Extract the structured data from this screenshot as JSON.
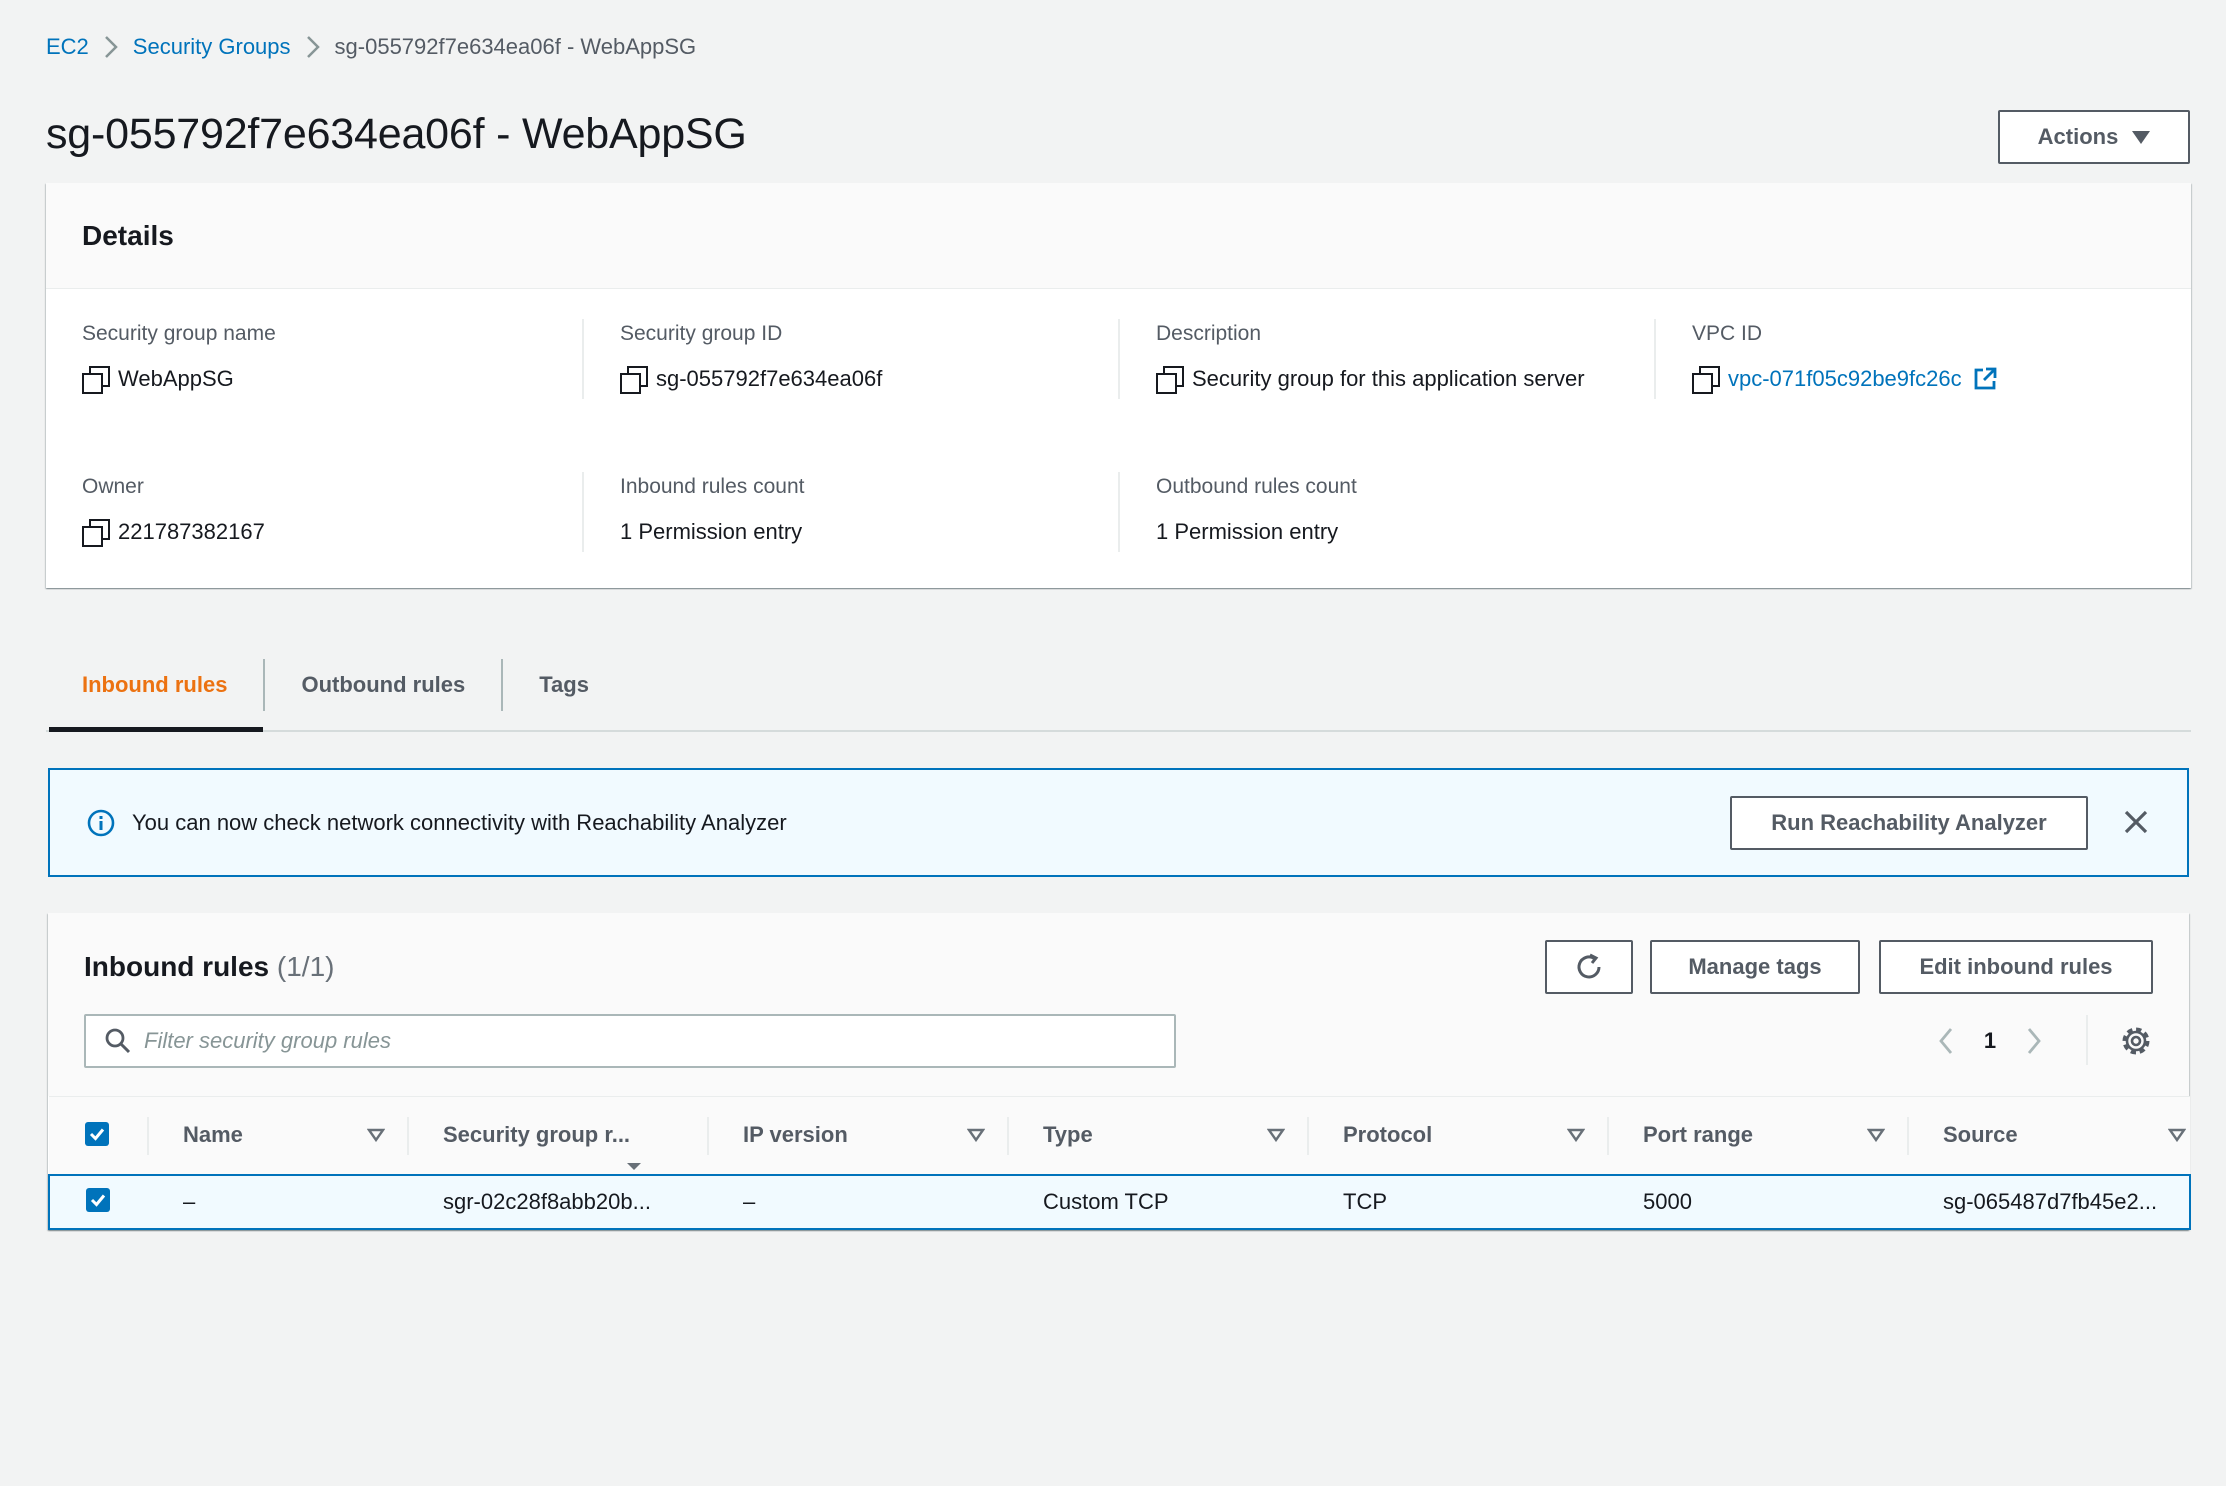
{
  "breadcrumb": {
    "root": "EC2",
    "parent": "Security Groups",
    "current": "sg-055792f7e634ea06f - WebAppSG"
  },
  "page": {
    "title": "sg-055792f7e634ea06f - WebAppSG",
    "actions_label": "Actions"
  },
  "details": {
    "heading": "Details",
    "fields": {
      "sg_name": {
        "label": "Security group name",
        "value": "WebAppSG"
      },
      "sg_id": {
        "label": "Security group ID",
        "value": "sg-055792f7e634ea06f"
      },
      "description": {
        "label": "Description",
        "value": "Security group for this application server"
      },
      "vpc_id": {
        "label": "VPC ID",
        "value": "vpc-071f05c92be9fc26c"
      },
      "owner": {
        "label": "Owner",
        "value": "221787382167"
      },
      "inbound_count": {
        "label": "Inbound rules count",
        "value": "1 Permission entry"
      },
      "outbound_count": {
        "label": "Outbound rules count",
        "value": "1 Permission entry"
      }
    }
  },
  "tabs": [
    {
      "label": "Inbound rules",
      "active": true
    },
    {
      "label": "Outbound rules",
      "active": false
    },
    {
      "label": "Tags",
      "active": false
    }
  ],
  "flash": {
    "text": "You can now check network connectivity with Reachability Analyzer",
    "button": "Run Reachability Analyzer"
  },
  "rules": {
    "title": "Inbound rules",
    "count": "(1/1)",
    "manage_tags": "Manage tags",
    "edit_rules": "Edit inbound rules",
    "search_placeholder": "Filter security group rules",
    "page": "1",
    "columns": [
      "Name",
      "Security group r...",
      "IP version",
      "Type",
      "Protocol",
      "Port range",
      "Source"
    ],
    "rows": [
      {
        "name": "–",
        "rule_id": "sgr-02c28f8abb20b...",
        "ip_version": "–",
        "type": "Custom TCP",
        "protocol": "TCP",
        "port_range": "5000",
        "source": "sg-065487d7fb45e2..."
      }
    ]
  },
  "colors": {
    "accent": "#ec7211",
    "link": "#0073bb",
    "selected_row_bg": "#f1faff"
  }
}
